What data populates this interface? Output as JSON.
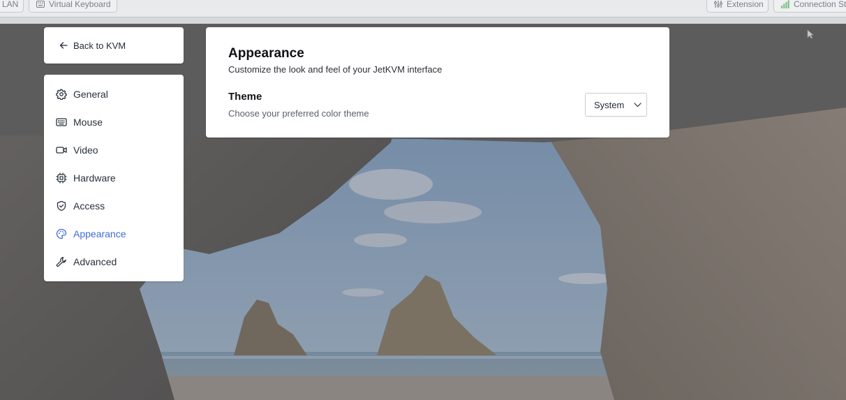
{
  "toolbar": {
    "lan_label": "LAN",
    "virtual_keyboard_label": "Virtual Keyboard",
    "extension_label": "Extension",
    "connection_label": "Connection Stats"
  },
  "back": {
    "label": "Back to KVM"
  },
  "sidebar": {
    "active_index": 5,
    "accent_color": "#3f6bd8",
    "items": [
      {
        "label": "General",
        "icon": "gear-icon"
      },
      {
        "label": "Mouse",
        "icon": "keyboard-icon"
      },
      {
        "label": "Video",
        "icon": "video-icon"
      },
      {
        "label": "Hardware",
        "icon": "cpu-icon"
      },
      {
        "label": "Access",
        "icon": "shield-icon"
      },
      {
        "label": "Appearance",
        "icon": "palette-icon"
      },
      {
        "label": "Advanced",
        "icon": "wrench-icon"
      }
    ]
  },
  "main": {
    "title": "Appearance",
    "subtitle": "Customize the look and feel of your JetKVM interface",
    "theme": {
      "title": "Theme",
      "description": "Choose your preferred color theme",
      "selected": "System"
    }
  }
}
